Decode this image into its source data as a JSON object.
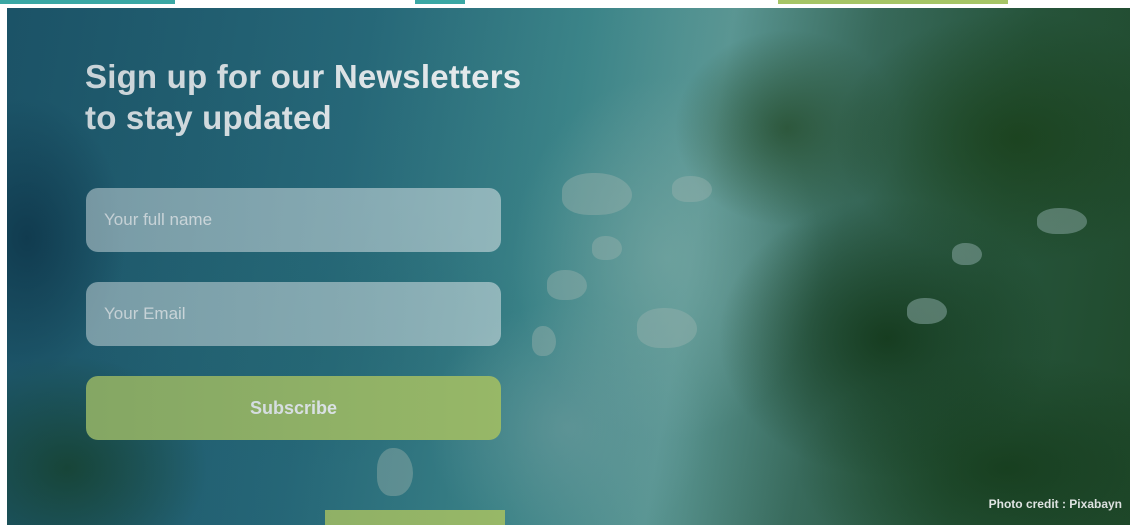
{
  "newsletter": {
    "heading_line1": "Sign up for our Newsletters",
    "heading_line2": "to stay updated",
    "name_placeholder": "Your full name",
    "email_placeholder": "Your Email",
    "subscribe_label": "Subscribe"
  },
  "photo_credit": "Photo credit : Pixabayn",
  "colors": {
    "accent_green": "#a7c66a",
    "accent_teal": "#3aa7a4",
    "overlay_teal": "#2a6f7f",
    "text": "#ffffff"
  }
}
